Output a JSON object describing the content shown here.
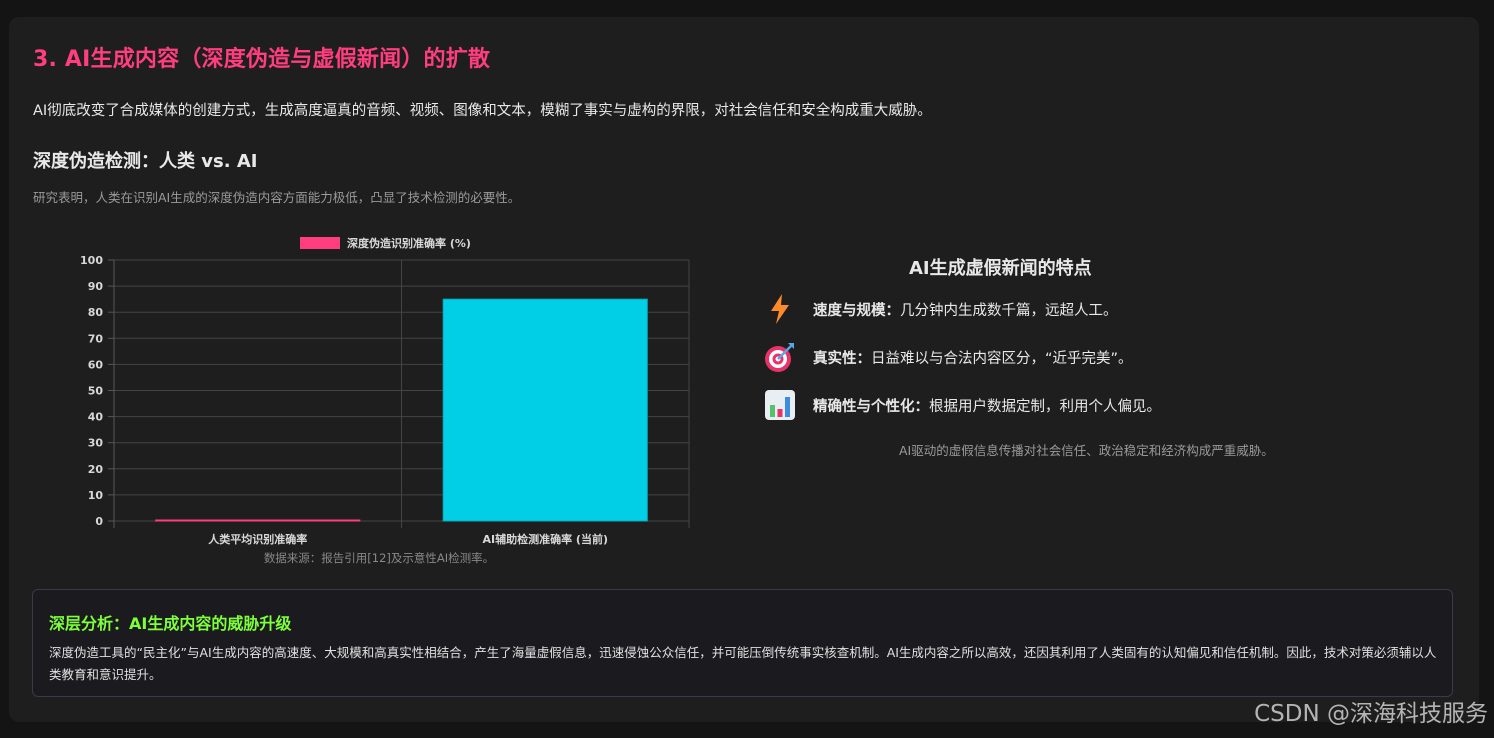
{
  "title": "3. AI生成内容（深度伪造与虚假新闻）的扩散",
  "intro": "AI彻底改变了合成媒体的创建方式，生成高度逼真的音频、视频、图像和文本，模糊了事实与虚构的界限，对社会信任和安全构成重大威胁。",
  "detection": {
    "heading": "深度伪造检测：人类 vs. AI",
    "note": "研究表明，人类在识别AI生成的深度伪造内容方面能力极低，凸显了技术检测的必要性。",
    "source": "数据来源：报告引用[12]及示意性AI检测率。"
  },
  "chart_data": {
    "type": "bar",
    "categories": [
      "人类平均识别准确率",
      "AI辅助检测准确率 (当前)"
    ],
    "series": [
      {
        "name": "深度伪造识别准确率 (%)",
        "values": [
          0.1,
          85
        ],
        "colors": [
          "#ff3d7f",
          "#00cfe6"
        ]
      }
    ],
    "ylim": [
      0,
      100
    ],
    "yticks": [
      0,
      10,
      20,
      30,
      40,
      50,
      60,
      70,
      80,
      90,
      100
    ],
    "grid": true,
    "legend": "top-center",
    "legend_color": "#ff3d7f"
  },
  "features": {
    "title": "AI生成虚假新闻的特点",
    "items": [
      {
        "icon": "lightning-icon",
        "label": "速度与规模：",
        "text": "几分钟内生成数千篇，远超人工。"
      },
      {
        "icon": "target-icon",
        "label": "真实性：",
        "text": "日益难以与合法内容区分，“近乎完美”。"
      },
      {
        "icon": "bar-chart-icon",
        "label": "精确性与个性化：",
        "text": "根据用户数据定制，利用个人偏见。"
      }
    ],
    "note": "AI驱动的虚假信息传播对社会信任、政治稳定和经济构成严重威胁。"
  },
  "analysis": {
    "heading": "深层分析：AI生成内容的威胁升级",
    "body": "深度伪造工具的“民主化”与AI生成内容的高速度、大规模和高真实性相结合，产生了海量虚假信息，迅速侵蚀公众信任，并可能压倒传统事实核查机制。AI生成内容之所以高效，还因其利用了人类固有的认知偏见和信任机制。因此，技术对策必须辅以人类教育和意识提升。"
  },
  "watermark": "CSDN @深海科技服务",
  "colors": {
    "title": "#ff3d7f",
    "analysis_heading": "#7dff3a",
    "bar_human": "#ff3d7f",
    "bar_ai": "#00cfe6"
  }
}
